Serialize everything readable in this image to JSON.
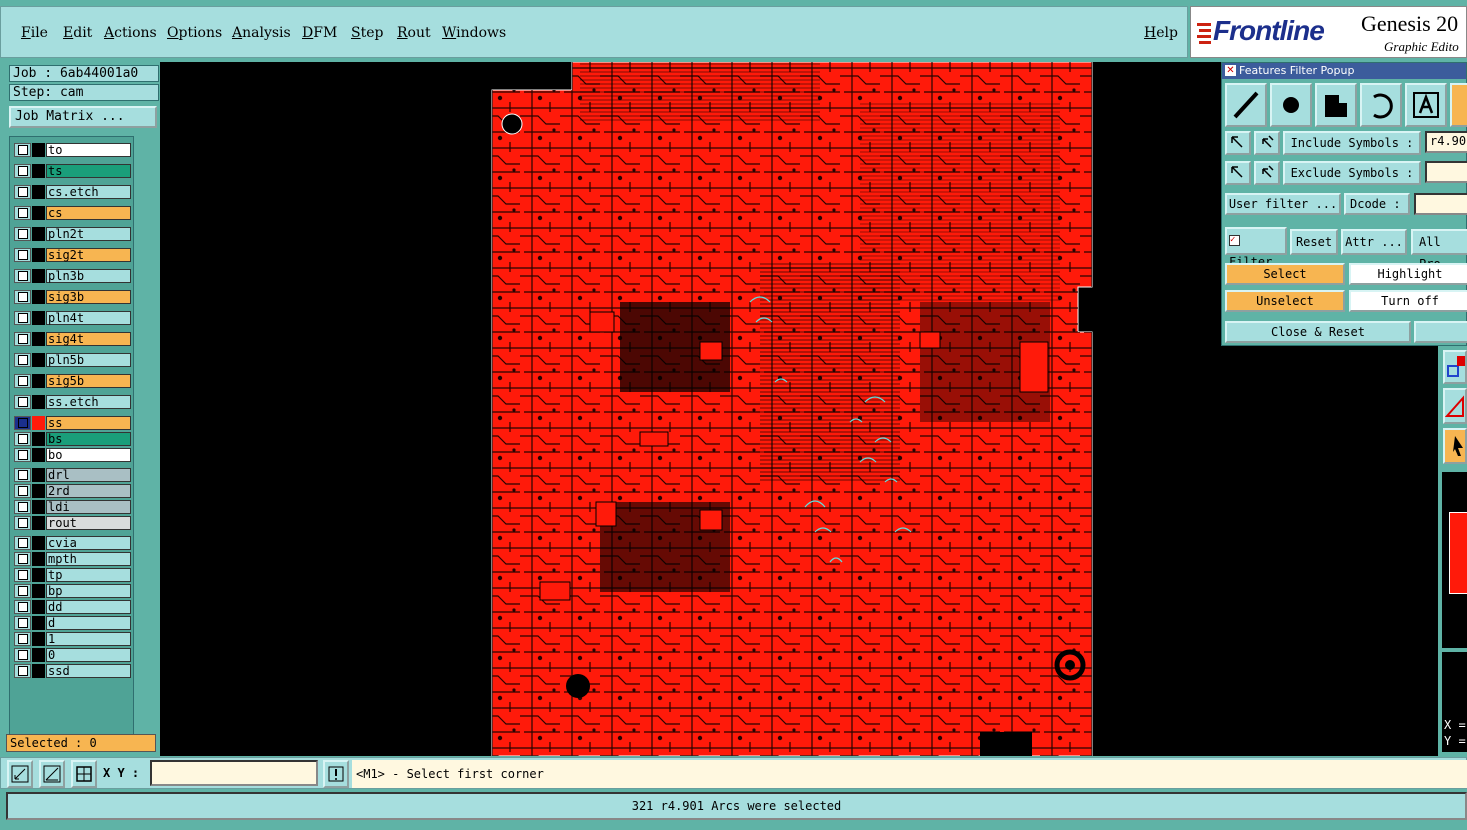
{
  "menu": {
    "file": "File",
    "edit": "Edit",
    "actions": "Actions",
    "options": "Options",
    "analysis": "Analysis",
    "dfm": "DFM",
    "step": "Step",
    "rout": "Rout",
    "windows": "Windows",
    "help": "Help"
  },
  "logo": {
    "brand": "Frontline",
    "product": "Genesis 20",
    "subtitle": "Graphic Edito"
  },
  "job": {
    "job_label": "Job : 6ab44001a0",
    "step_label": "Step: cam",
    "matrix_button": "Job Matrix ..."
  },
  "layers": [
    {
      "name": "to",
      "color": "#ffffff"
    },
    {
      "name": "ts",
      "color": "#1a9e7a"
    },
    {
      "name": "cs.etch",
      "color": "#a6dede"
    },
    {
      "name": "cs",
      "color": "#f7b551"
    },
    {
      "name": "pln2t",
      "color": "#a6dede"
    },
    {
      "name": "sig2t",
      "color": "#f7b551"
    },
    {
      "name": "pln3b",
      "color": "#a6dede"
    },
    {
      "name": "sig3b",
      "color": "#f7b551"
    },
    {
      "name": "pln4t",
      "color": "#a6dede"
    },
    {
      "name": "sig4t",
      "color": "#f7b551"
    },
    {
      "name": "pln5b",
      "color": "#a6dede"
    },
    {
      "name": "sig5b",
      "color": "#f7b551"
    },
    {
      "name": "ss.etch",
      "color": "#a6dede"
    },
    {
      "name": "ss",
      "color": "#f7b551"
    },
    {
      "name": "bs",
      "color": "#1a9e7a"
    },
    {
      "name": "bo",
      "color": "#ffffff"
    },
    {
      "name": "drl",
      "color": "#a9bfc4"
    },
    {
      "name": "2rd",
      "color": "#a9bfc4"
    },
    {
      "name": "ldi",
      "color": "#a9bfc4"
    },
    {
      "name": "rout",
      "color": "#d9dcdc"
    },
    {
      "name": "cvia",
      "color": "#a6dede"
    },
    {
      "name": "mpth",
      "color": "#a6dede"
    },
    {
      "name": "tp",
      "color": "#a6dede"
    },
    {
      "name": "bp",
      "color": "#a6dede"
    },
    {
      "name": "dd",
      "color": "#a6dede"
    },
    {
      "name": "d",
      "color": "#a6dede"
    },
    {
      "name": "1",
      "color": "#a6dede"
    },
    {
      "name": "0",
      "color": "#a6dede"
    },
    {
      "name": "ssd",
      "color": "#a6dede"
    }
  ],
  "selected_count": "Selected : 0",
  "popup": {
    "title": "Features Filter Popup",
    "include_symbols": "Include Symbols :",
    "include_value": "r4.90",
    "exclude_symbols": "Exclude Symbols :",
    "user_filter": "User filter ...",
    "dcode": "Dcode :",
    "filter": "Filter",
    "reset": "Reset",
    "attr": "Attr ...",
    "all_pro": "All Pro",
    "select": "Select",
    "highlight": "Highlight",
    "unselect": "Unselect",
    "turn_off": "Turn off",
    "close_reset": "Close & Reset"
  },
  "cmd": {
    "xy_label": "X Y :",
    "prompt": "<M1> - Select first corner"
  },
  "status": "321 r4.901 Arcs were selected",
  "coords": {
    "x_label": "X =",
    "y_label": "Y ="
  },
  "colors": {
    "board": "#ff1a0a",
    "panel": "#5fb3a6",
    "button": "#a6dede",
    "active": "#f7b551",
    "trace_dark": "#000000",
    "highlight": "#5fe0e0"
  }
}
